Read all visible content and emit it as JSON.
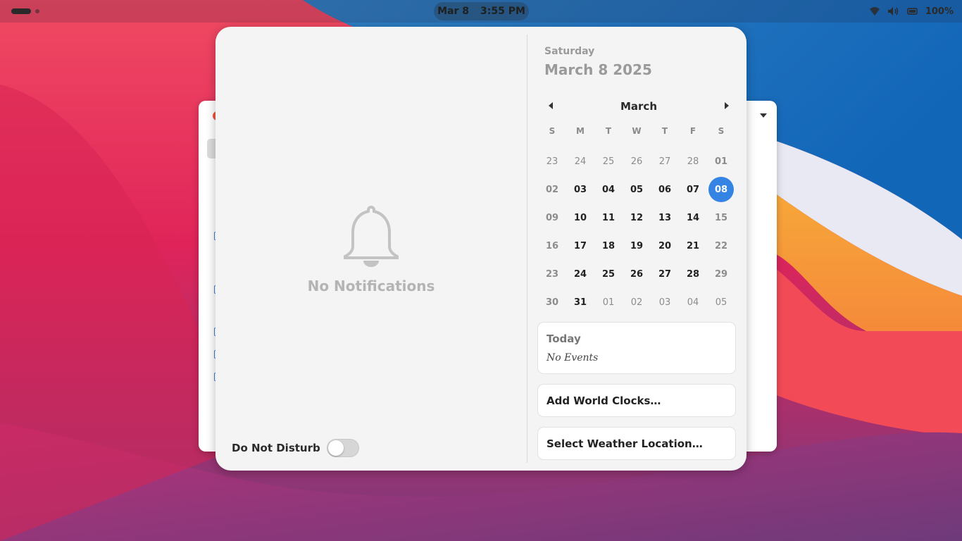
{
  "topbar": {
    "date": "Mar 8",
    "time": "3:55 PM",
    "battery": "100%"
  },
  "notifications": {
    "empty_label": "No Notifications",
    "dnd_label": "Do Not Disturb",
    "dnd_enabled": false
  },
  "date_header": {
    "weekday": "Saturday",
    "date": "March 8 2025"
  },
  "calendar": {
    "month": "March",
    "weekdays": [
      "S",
      "M",
      "T",
      "W",
      "T",
      "F",
      "S"
    ],
    "weeks": [
      [
        "23",
        "24",
        "25",
        "26",
        "27",
        "28",
        "01"
      ],
      [
        "02",
        "03",
        "04",
        "05",
        "06",
        "07",
        "08"
      ],
      [
        "09",
        "10",
        "11",
        "12",
        "13",
        "14",
        "15"
      ],
      [
        "16",
        "17",
        "18",
        "19",
        "20",
        "21",
        "22"
      ],
      [
        "23",
        "24",
        "25",
        "26",
        "27",
        "28",
        "29"
      ],
      [
        "30",
        "31",
        "01",
        "02",
        "03",
        "04",
        "05"
      ]
    ],
    "selected_day": "08",
    "accent_color": "#3584e4"
  },
  "events": {
    "title": "Today",
    "empty_label": "No Events"
  },
  "world_clocks": {
    "label": "Add World Clocks…"
  },
  "weather": {
    "label": "Select Weather Location…"
  }
}
